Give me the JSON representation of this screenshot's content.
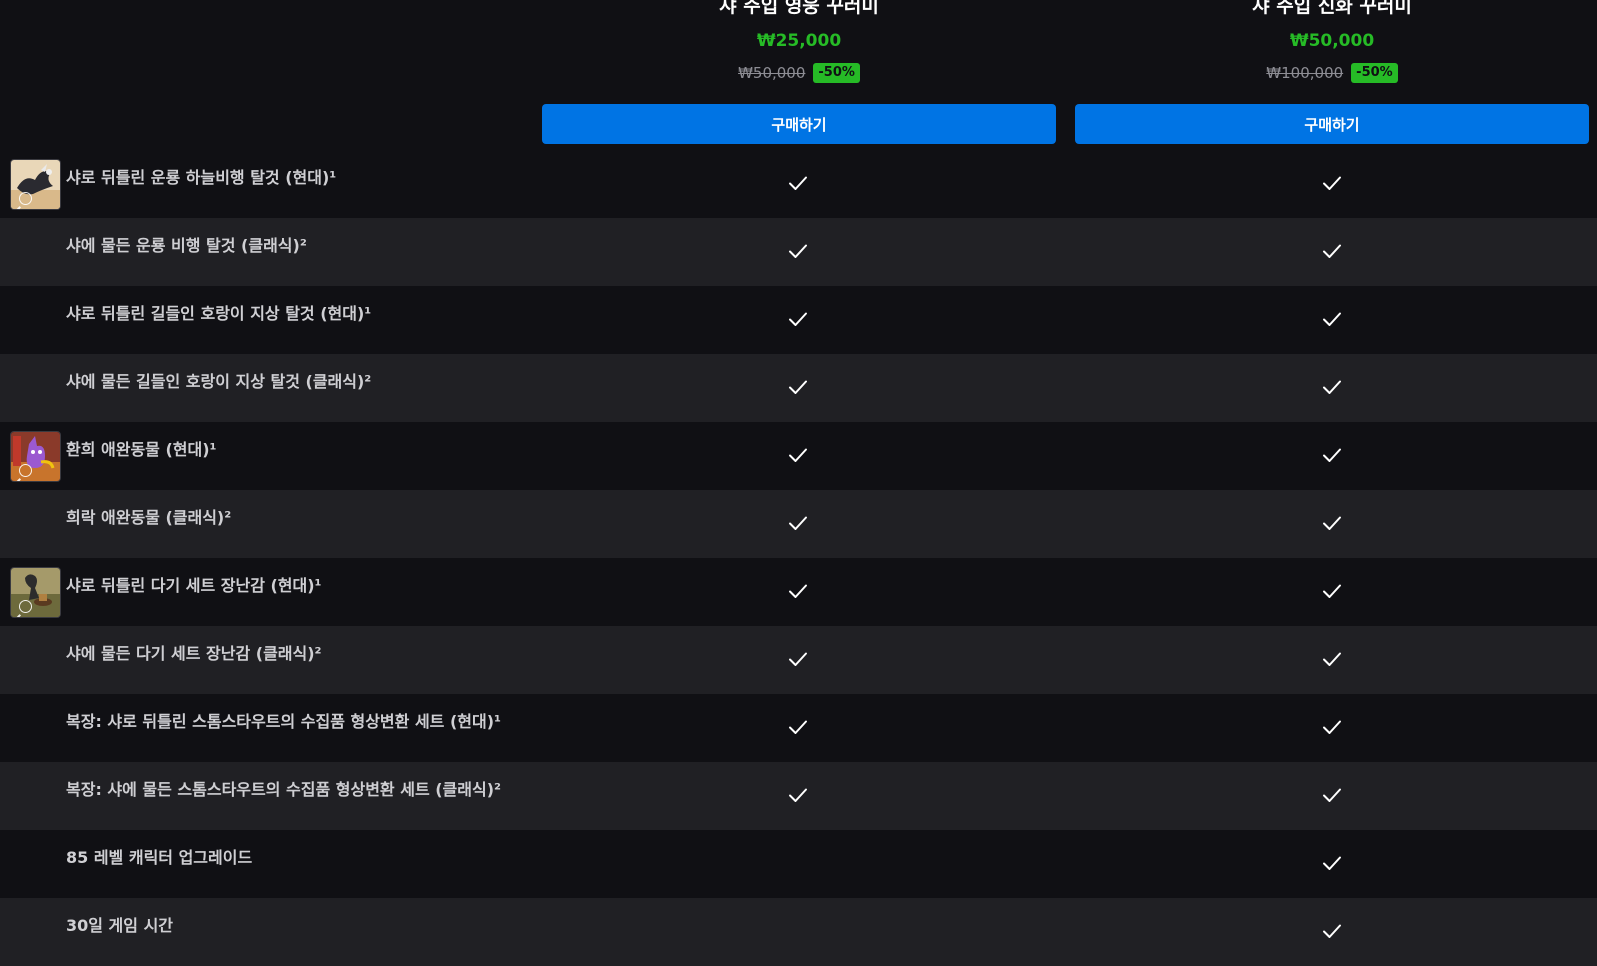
{
  "plans": [
    {
      "title": "샤 주입 영웅 꾸러미",
      "price": "₩25,000",
      "original_price": "₩50,000",
      "discount": "-50%",
      "buy_label": "구매하기"
    },
    {
      "title": "샤 주입 신화 꾸러미",
      "price": "₩50,000",
      "original_price": "₩100,000",
      "discount": "-50%",
      "buy_label": "구매하기"
    }
  ],
  "features": [
    {
      "label": "샤로 뒤틀린 운룡 하늘비행 탈것 (현대)¹",
      "thumbnail": "cloud-serpent-mount",
      "plan1": true,
      "plan2": true
    },
    {
      "label": "샤에 물든 운룡 비행 탈것 (클래식)²",
      "plan1": true,
      "plan2": true
    },
    {
      "label": "샤로 뒤틀린 길들인 호랑이 지상 탈것 (현대)¹",
      "plan1": true,
      "plan2": true
    },
    {
      "label": "샤에 물든 길들인 호랑이 지상 탈것 (클래식)²",
      "plan1": true,
      "plan2": true
    },
    {
      "label": "환희 애완동물 (현대)¹",
      "thumbnail": "pet",
      "plan1": true,
      "plan2": true
    },
    {
      "label": "희락 애완동물 (클래식)²",
      "plan1": true,
      "plan2": true
    },
    {
      "label": "샤로 뒤틀린 다기 세트 장난감 (현대)¹",
      "thumbnail": "tea-set-toy",
      "plan1": true,
      "plan2": true
    },
    {
      "label": "샤에 물든 다기 세트 장난감 (클래식)²",
      "plan1": true,
      "plan2": true
    },
    {
      "label": "복장: 샤로 뒤틀린 스톰스타우트의 수집품 형상변환 세트 (현대)¹",
      "plan1": true,
      "plan2": true
    },
    {
      "label": "복장: 샤에 물든 스톰스타우트의 수집품 형상변환 세트 (클래식)²",
      "plan1": true,
      "plan2": true
    },
    {
      "label": "85 레벨 캐릭터 업그레이드",
      "plan1": false,
      "plan2": true
    },
    {
      "label": "30일 게임 시간",
      "plan1": false,
      "plan2": true
    }
  ],
  "colors": {
    "background": "#101014",
    "row_alt": "#202024",
    "accent_green": "#26bb26",
    "button_blue": "#0074e4"
  }
}
